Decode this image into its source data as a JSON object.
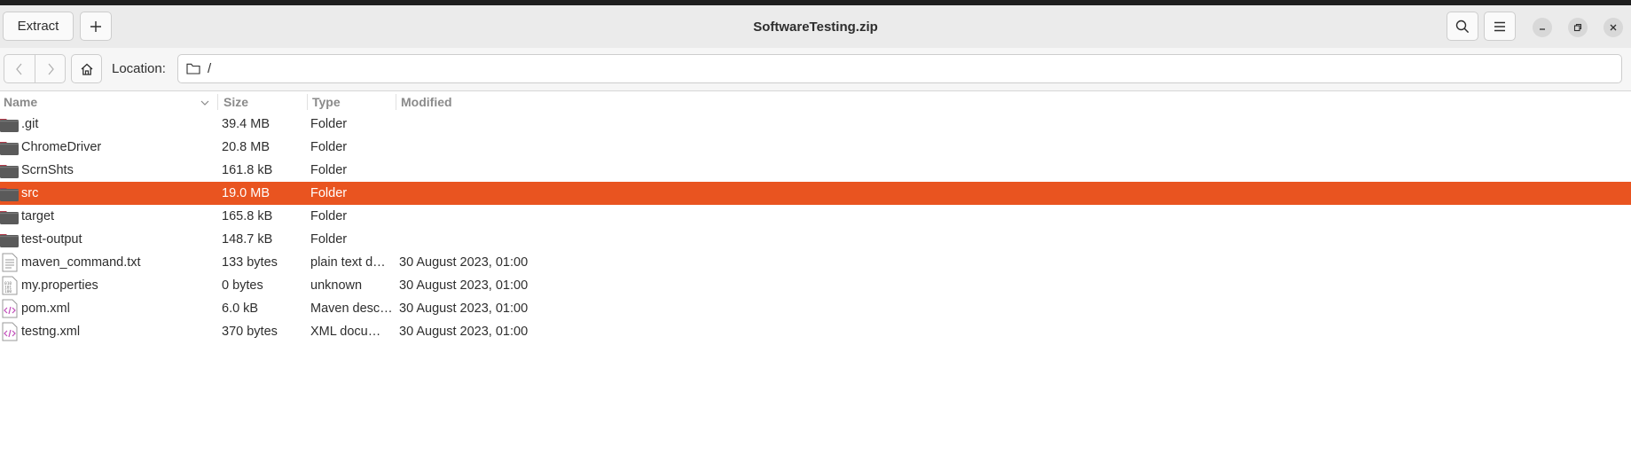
{
  "window": {
    "title": "SoftwareTesting.zip"
  },
  "header": {
    "extract_label": "Extract",
    "add_label": "+"
  },
  "location": {
    "label": "Location:",
    "path": "/"
  },
  "columns": {
    "name": "Name",
    "size": "Size",
    "type": "Type",
    "modified": "Modified"
  },
  "files": [
    {
      "name": ".git",
      "size": "39.4 MB",
      "type": "Folder",
      "modified": "",
      "icon": "folder-icon"
    },
    {
      "name": "ChromeDriver",
      "size": "20.8 MB",
      "type": "Folder",
      "modified": "",
      "icon": "folder-icon"
    },
    {
      "name": "ScrnShts",
      "size": "161.8 kB",
      "type": "Folder",
      "modified": "",
      "icon": "folder-icon"
    },
    {
      "name": "src",
      "size": "19.0 MB",
      "type": "Folder",
      "modified": "",
      "icon": "folder-icon",
      "selected": true
    },
    {
      "name": "target",
      "size": "165.8 kB",
      "type": "Folder",
      "modified": "",
      "icon": "folder-icon"
    },
    {
      "name": "test-output",
      "size": "148.7 kB",
      "type": "Folder",
      "modified": "",
      "icon": "folder-icon"
    },
    {
      "name": "maven_command.txt",
      "size": "133 bytes",
      "type": "plain text d…",
      "modified": "30 August 2023, 01:00",
      "icon": "text-file-icon"
    },
    {
      "name": "my.properties",
      "size": "0 bytes",
      "type": "unknown",
      "modified": "30 August 2023, 01:00",
      "icon": "binary-file-icon"
    },
    {
      "name": "pom.xml",
      "size": "6.0 kB",
      "type": "Maven desc…",
      "modified": "30 August 2023, 01:00",
      "icon": "xml-file-icon"
    },
    {
      "name": "testng.xml",
      "size": "370 bytes",
      "type": "XML docu…",
      "modified": "30 August 2023, 01:00",
      "icon": "xml-file-icon"
    }
  ],
  "colors": {
    "selection": "#e95420",
    "folder": "#5a5a5a",
    "folder_tab": "#b33a4a",
    "xml_icon": "#c04bb9"
  }
}
